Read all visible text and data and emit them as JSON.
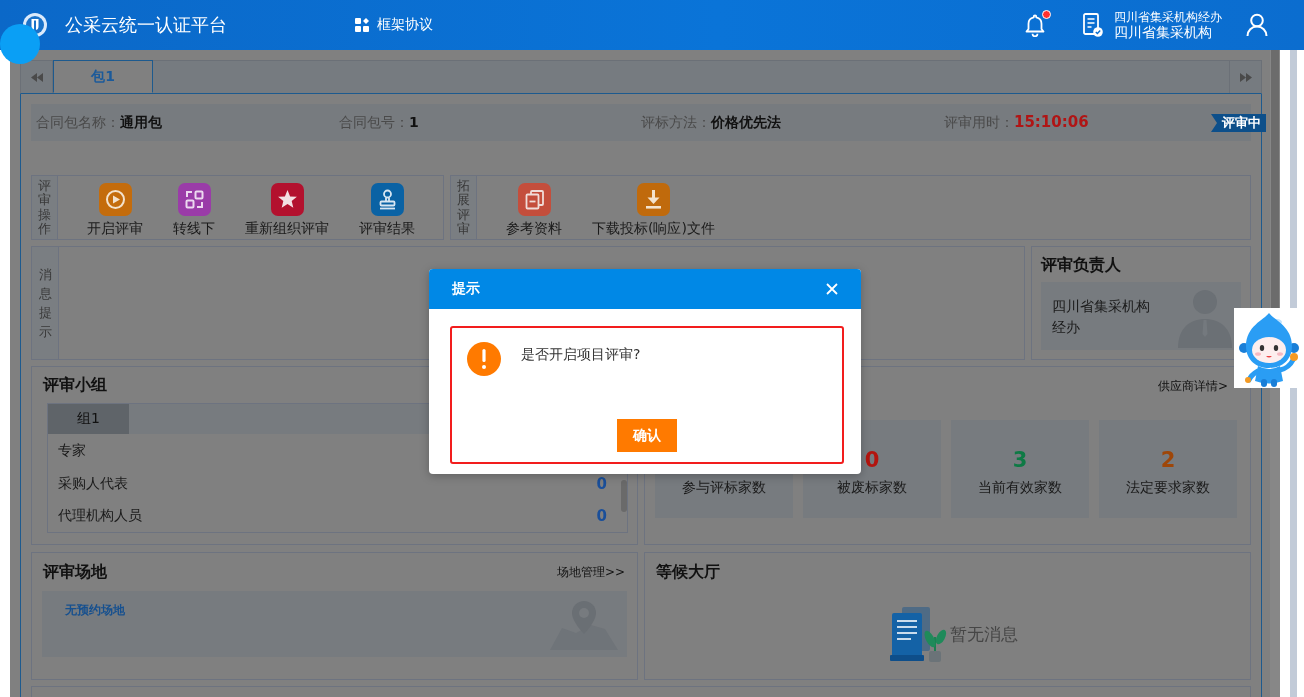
{
  "header": {
    "title": "公采云统一认证平台",
    "nav": [
      {
        "label": "框架协议"
      }
    ],
    "bell_dot": true,
    "account": {
      "name": "四川省集采机构经办",
      "org": "四川省集采机构"
    }
  },
  "tabs": [
    {
      "label": "包1",
      "selected": true
    }
  ],
  "info": [
    {
      "label": "合同包名称：",
      "value": "通用包",
      "kind": "text"
    },
    {
      "label": "合同包号：",
      "value": "1",
      "kind": "text"
    },
    {
      "label": "评标方法：",
      "value": "价格优先法",
      "kind": "text"
    },
    {
      "label": "评审用时：",
      "value": "15:10:06",
      "kind": "timer"
    }
  ],
  "status_badge": "评审中",
  "toolbar_groups": [
    {
      "label": "评审操作",
      "actions": [
        "开启评审",
        "转线下",
        "重新组织评审",
        "评审结果"
      ]
    },
    {
      "label": "拓展评审",
      "actions": [
        "参考资料",
        "下载投标(响应)文件"
      ]
    }
  ],
  "messages": {
    "label": "消息提示"
  },
  "leader": {
    "title": "评审负责人",
    "name": "四川省集采机构经办"
  },
  "review_group": {
    "title": "评审小组",
    "tabs": [
      {
        "label": "组1",
        "selected": true
      }
    ],
    "members": [
      {
        "role": "专家"
      },
      {
        "role": "采购人代表",
        "count": "0"
      },
      {
        "role": "代理机构人员",
        "count": "0"
      }
    ]
  },
  "suppliers": {
    "link": "供应商详情>",
    "stats": [
      {
        "label": "参与评标家数"
      },
      {
        "value": "0",
        "label": "被废标家数",
        "color": "#b3150f"
      },
      {
        "value": "3",
        "label": "当前有效家数",
        "color": "#0e7a45"
      },
      {
        "value": "2",
        "label": "法定要求家数",
        "color": "#9e4608"
      }
    ]
  },
  "venue": {
    "title": "评审场地",
    "link": "场地管理>>",
    "empty": "无预约场地"
  },
  "lobby": {
    "title": "等候大厅",
    "empty": "暂无消息"
  },
  "dialog": {
    "title": "提示",
    "message": "是否开启项目评审?",
    "confirm": "确认"
  }
}
